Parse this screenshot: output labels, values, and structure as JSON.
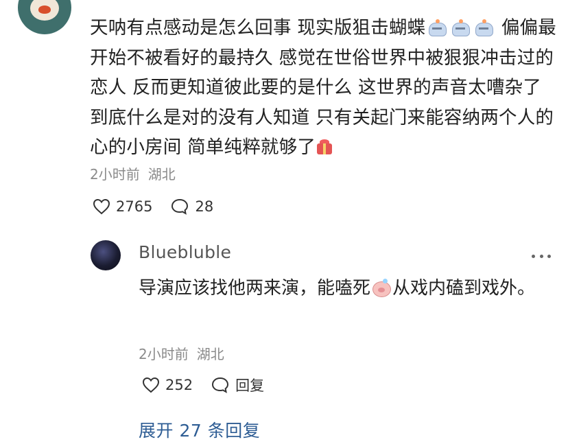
{
  "main_comment": {
    "text_parts": [
      "天呐有点感动是怎么回事 现实版狙击蝴蝶",
      " 偏偏最开始不被看好的最持久 感觉在世俗世界中被狠狠冲击过的恋人 反而更知道彼此要的是什么 这世界的声音太嘈杂了 到底什么是对的没有人知道 只有关起门来能容纳两个人的心的小房间 简单纯粹就够了"
    ],
    "time": "2小时前",
    "location": "湖北",
    "likes": "2765",
    "comments": "28"
  },
  "reply": {
    "username": "Bluebluble",
    "text_parts": [
      "导演应该找他两来演，能嗑死",
      "从戏内磕到戏外。"
    ],
    "time": "2小时前",
    "location": "湖北",
    "likes": "252",
    "reply_label": "回复"
  },
  "expand_replies": "展开 27 条回复",
  "icons": {
    "main_avatar": "avatar-icon",
    "reply_avatar": "avatar-icon",
    "heart": "heart-icon",
    "comment": "comment-bubble-icon",
    "more": "more-horizontal-icon",
    "emoji_upset": "upset-emoji-icon",
    "emoji_gift": "gift-icon",
    "emoji_pig": "pig-emoji-icon"
  },
  "colors": {
    "text": "#222222",
    "meta": "#8a8a8a",
    "link": "#2e5d94",
    "username": "#555555"
  }
}
